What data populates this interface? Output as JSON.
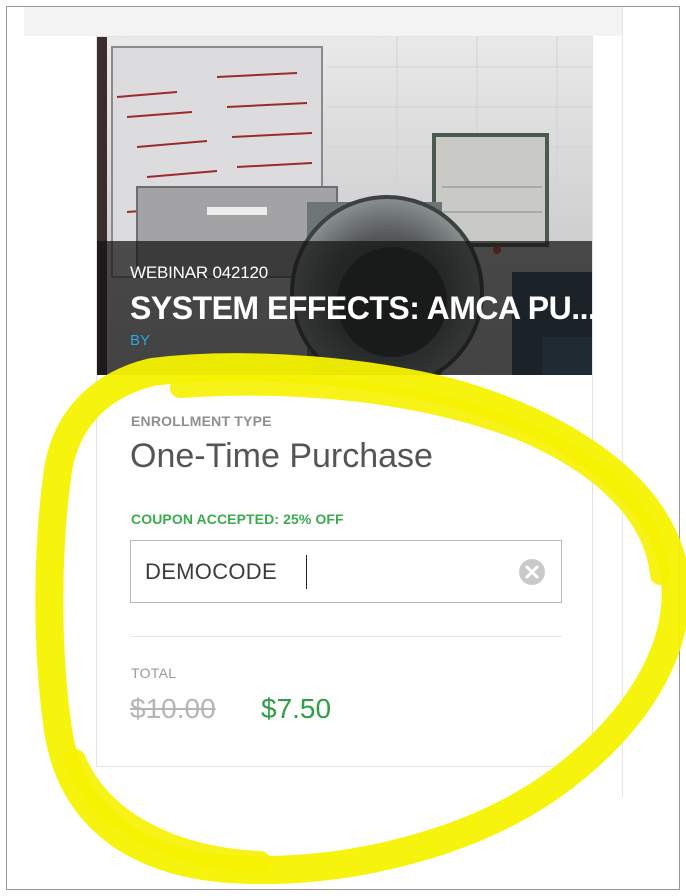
{
  "course_card": {
    "webinar_id": "WEBINAR 042120",
    "title": "SYSTEM EFFECTS: AMCA PU...",
    "by_label": "BY",
    "hero_image": "fan-test-lab-photo"
  },
  "enrollment": {
    "label": "ENROLLMENT TYPE",
    "value": "One-Time Purchase"
  },
  "coupon": {
    "status": "COUPON ACCEPTED: 25% OFF",
    "code": "DEMOCODE",
    "clear_icon": "clear-circle-icon"
  },
  "total": {
    "label": "TOTAL",
    "original_price": "$10.00",
    "discounted_price": "$7.50"
  },
  "colors": {
    "accent_green": "#3bab4e",
    "link_blue": "#2aa7e0",
    "highlight_yellow": "#f6f200"
  }
}
